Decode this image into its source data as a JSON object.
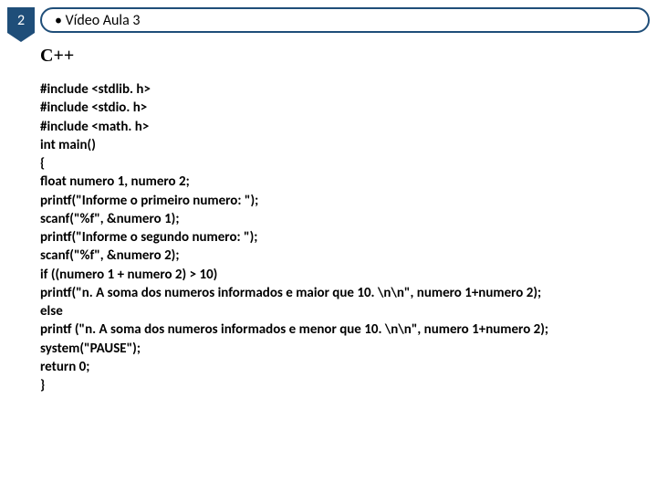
{
  "header": {
    "number": "2",
    "title_bullet": "• Vídeo Aula 3"
  },
  "subtitle": "C++",
  "code": {
    "l1": "#include <stdlib. h>",
    "l2": "#include <stdio. h>",
    "l3": "#include <math. h>",
    "l4": "int main()",
    "l5": "{",
    "l6": "float numero 1, numero 2;",
    "l7": "printf(\"Informe o primeiro numero: \");",
    "l8": "scanf(\"%f\", &numero 1);",
    "l9": "printf(\"Informe o segundo numero: \");",
    "l10": "scanf(\"%f\", &numero 2);",
    "l11": "if ((numero 1 + numero 2) > 10)",
    "l12": "printf(\"n. A soma dos numeros informados e maior que 10. \\n\\n\", numero 1+numero 2);",
    "l13": "else",
    "l14": "printf (\"n. A soma dos numeros informados e menor que 10. \\n\\n\", numero 1+numero 2);",
    "l15": "system(\"PAUSE\");",
    "l16": "return 0;",
    "l17": "}"
  }
}
